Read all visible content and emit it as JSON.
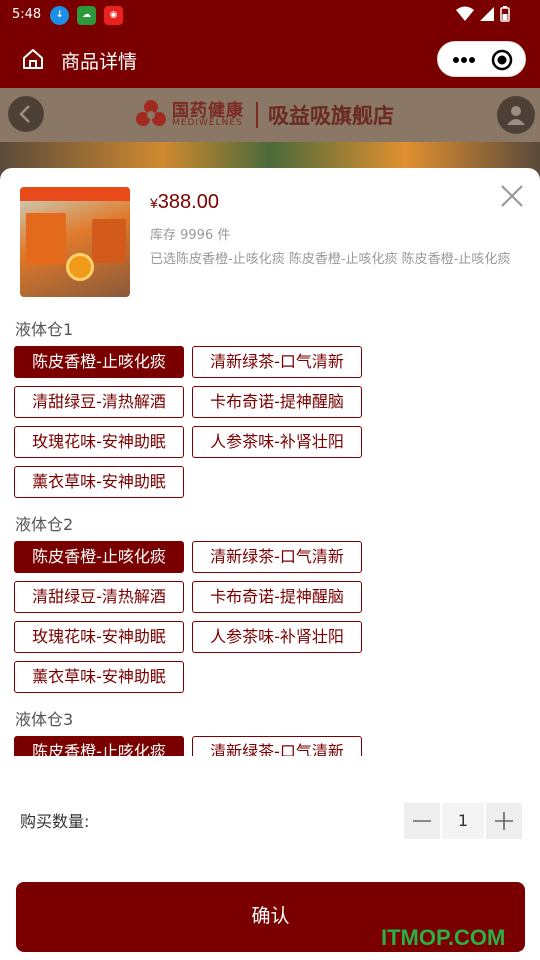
{
  "status_bar": {
    "time": "5:48",
    "app_icons": [
      "download",
      "weather",
      "shop"
    ]
  },
  "header": {
    "title": "商品详情"
  },
  "background_page": {
    "brand_cn": "国药健康",
    "brand_en": "MEDIWELNES",
    "store_name": "吸益吸旗舰店"
  },
  "product": {
    "price_symbol": "¥",
    "price": "388.00",
    "stock": "库存 9996 件",
    "selected": "已选陈皮香橙-止咳化痰 陈皮香橙-止咳化痰 陈皮香橙-止咳化痰"
  },
  "groups": [
    {
      "title": "液体仓1",
      "options": [
        "陈皮香橙-止咳化痰",
        "清新绿茶-口气清新",
        "清甜绿豆-清热解酒",
        "卡布奇诺-提神醒脑",
        "玫瑰花味-安神助眠",
        "人参茶味-补肾壮阳",
        "薰衣草味-安神助眠"
      ],
      "selected_index": 0
    },
    {
      "title": "液体仓2",
      "options": [
        "陈皮香橙-止咳化痰",
        "清新绿茶-口气清新",
        "清甜绿豆-清热解酒",
        "卡布奇诺-提神醒脑",
        "玫瑰花味-安神助眠",
        "人参茶味-补肾壮阳",
        "薰衣草味-安神助眠"
      ],
      "selected_index": 0
    },
    {
      "title": "液体仓3",
      "options": [
        "陈皮香橙-止咳化痰",
        "清新绿茶-口气清新"
      ],
      "selected_index": 0
    }
  ],
  "quantity": {
    "label": "购买数量:",
    "value": "1"
  },
  "confirm_label": "确认",
  "watermark": "ITMOP.COM",
  "colors": {
    "brand": "#7a0000",
    "watermark": "#2ab043"
  }
}
